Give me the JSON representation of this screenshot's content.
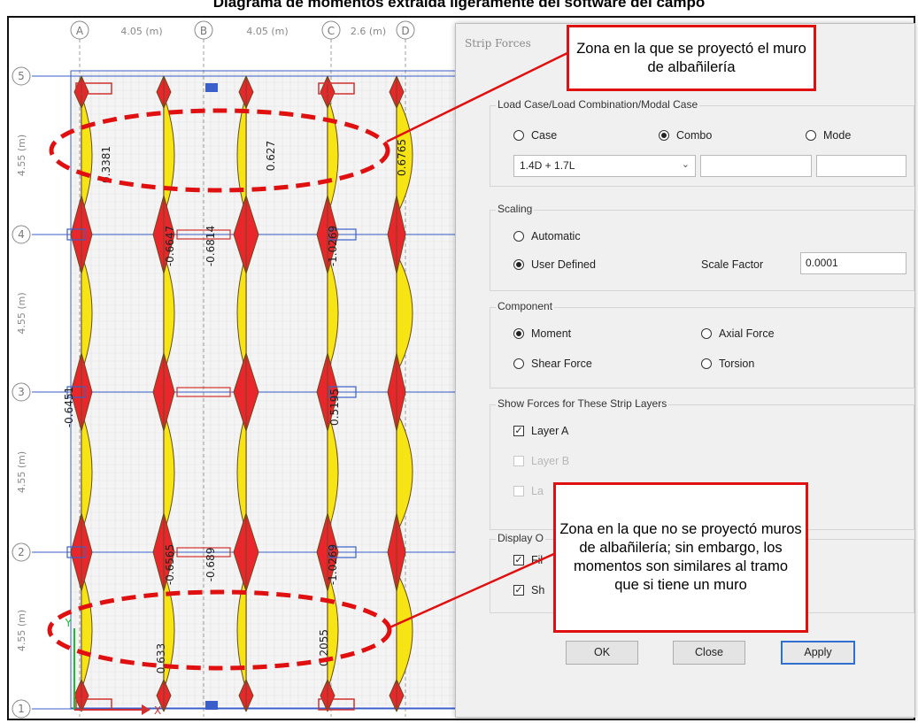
{
  "figure": {
    "title": "Diagrama de momentos extraída ligeramente del software del campo"
  },
  "plan": {
    "column_axes": [
      "A",
      "B",
      "C",
      "D"
    ],
    "column_spacings": [
      "4.05 (m)",
      "4.05 (m)",
      "2.6 (m)"
    ],
    "row_axes": [
      "5",
      "4",
      "3",
      "2",
      "1"
    ],
    "row_spacings": [
      "4.55 (m)",
      "4.55 (m)",
      "4.55 (m)",
      "4.55 (m)"
    ],
    "moment_labels": [
      {
        "text": "0.3381"
      },
      {
        "text": "0.627"
      },
      {
        "text": "0.6765"
      },
      {
        "text": "-0.6647"
      },
      {
        "text": "-0.6814"
      },
      {
        "text": "-1.0269"
      },
      {
        "text": "-0.6451"
      },
      {
        "text": "0.5195"
      },
      {
        "text": "-0.6565"
      },
      {
        "text": "-0.689"
      },
      {
        "text": "-1.0269"
      },
      {
        "text": "0.633"
      },
      {
        "text": "0.2055"
      }
    ],
    "axis_x_label": "X",
    "axis_y_label": "Y",
    "colors": {
      "grid": "#3a5fc8",
      "positive": "#f7e414",
      "negative": "#e8262b",
      "outline": "#6a4a20"
    }
  },
  "dialog": {
    "title": "Strip Forces",
    "load_case": {
      "label": "Load Case/Load Combination/Modal Case",
      "options": [
        "Case",
        "Combo",
        "Mode"
      ],
      "selected": "Combo",
      "combo_value": "1.4D + 1.7L"
    },
    "scaling": {
      "label": "Scaling",
      "options": [
        "Automatic",
        "User Defined"
      ],
      "selected": "User Defined",
      "scale_factor_label": "Scale Factor",
      "scale_factor_value": "0.0001"
    },
    "component": {
      "label": "Component",
      "options": [
        "Moment",
        "Axial Force",
        "Shear Force",
        "Torsion"
      ],
      "selected": "Moment"
    },
    "layers": {
      "label": "Show Forces for These Strip Layers",
      "items": [
        {
          "label": "Layer A",
          "checked": true,
          "enabled": true
        },
        {
          "label": "Layer B",
          "checked": false,
          "enabled": false
        },
        {
          "label": "La",
          "checked": false,
          "enabled": false
        }
      ]
    },
    "display": {
      "label": "Display O",
      "items": [
        {
          "label": "Fil",
          "checked": true
        },
        {
          "label": "Sh",
          "checked": true
        }
      ]
    },
    "buttons": {
      "ok": "OK",
      "close": "Close",
      "apply": "Apply"
    }
  },
  "callouts": {
    "top": "Zona en la que se proyectó el muro de albañilería",
    "bottom": "Zona en la que no se proyectó muros de albañilería; sin embargo, los momentos son similares al tramo que si tiene un muro"
  }
}
